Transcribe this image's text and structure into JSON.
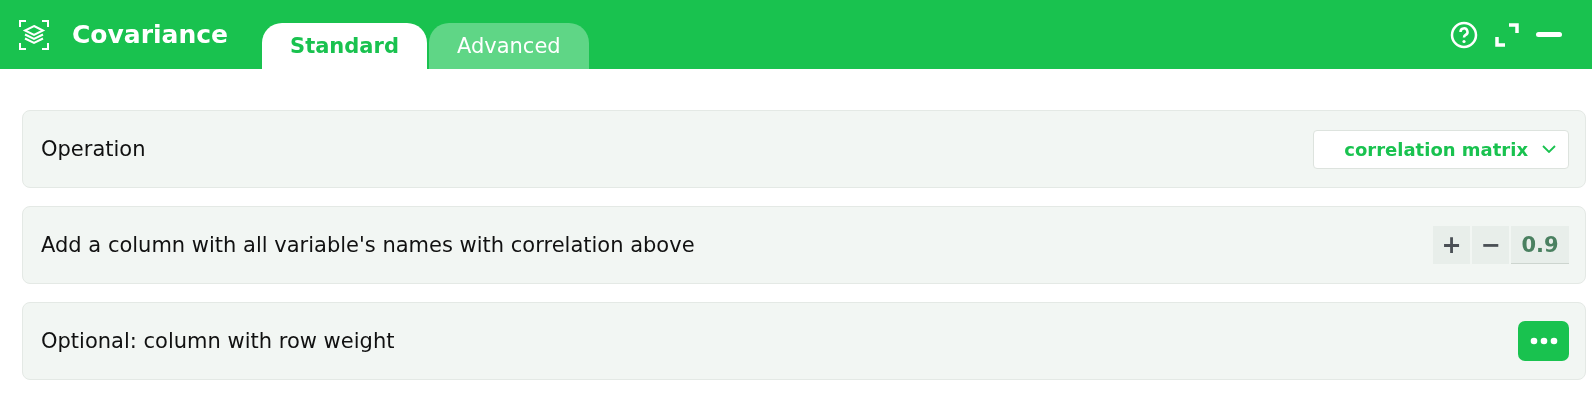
{
  "window": {
    "title": "Covariance"
  },
  "tabs": [
    {
      "label": "Standard",
      "selected": true
    },
    {
      "label": "Advanced",
      "selected": false
    }
  ],
  "rows": [
    {
      "kind": "select",
      "label": "Operation",
      "value": "correlation matrix"
    },
    {
      "kind": "stepper",
      "label": "Add a column with all variable's names with correlation above",
      "increment": "+",
      "decrement": "−",
      "value": "0.9"
    },
    {
      "kind": "picker",
      "label": "Optional: column with row weight"
    }
  ]
}
